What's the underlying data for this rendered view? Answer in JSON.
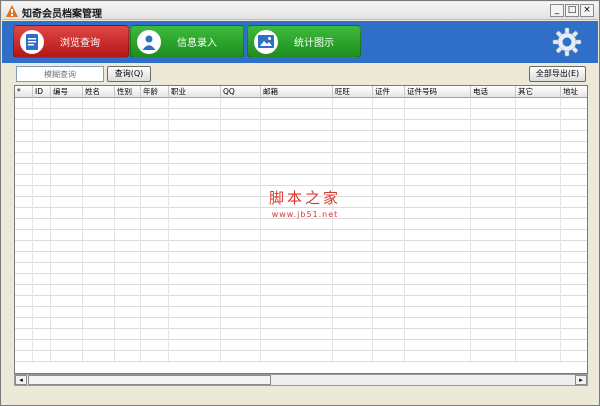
{
  "window": {
    "title": "知奇会员档案管理",
    "controls": [
      "_",
      "□",
      "×"
    ]
  },
  "nav": [
    {
      "label": "浏览查询",
      "icon": "document-icon",
      "color": "#c62020"
    },
    {
      "label": "信息录入",
      "icon": "user-icon",
      "color": "#2aa52a"
    },
    {
      "label": "统计图示",
      "icon": "image-icon",
      "color": "#2aa52a"
    }
  ],
  "toolbar": {
    "settings_icon": "gear-icon",
    "background": "#2f6fc8"
  },
  "search": {
    "placeholder": "模糊查询",
    "query_button": "查询(Q)",
    "export_button": "全部导出(E)"
  },
  "table": {
    "columns": [
      "*",
      "ID",
      "编号",
      "姓名",
      "性别",
      "年龄",
      "职业",
      "QQ",
      "邮箱",
      "旺旺",
      "证件",
      "证件号码",
      "电话",
      "其它",
      "地址"
    ]
  },
  "watermark": {
    "title": "脚本之家",
    "url": "www.jb51.net"
  }
}
